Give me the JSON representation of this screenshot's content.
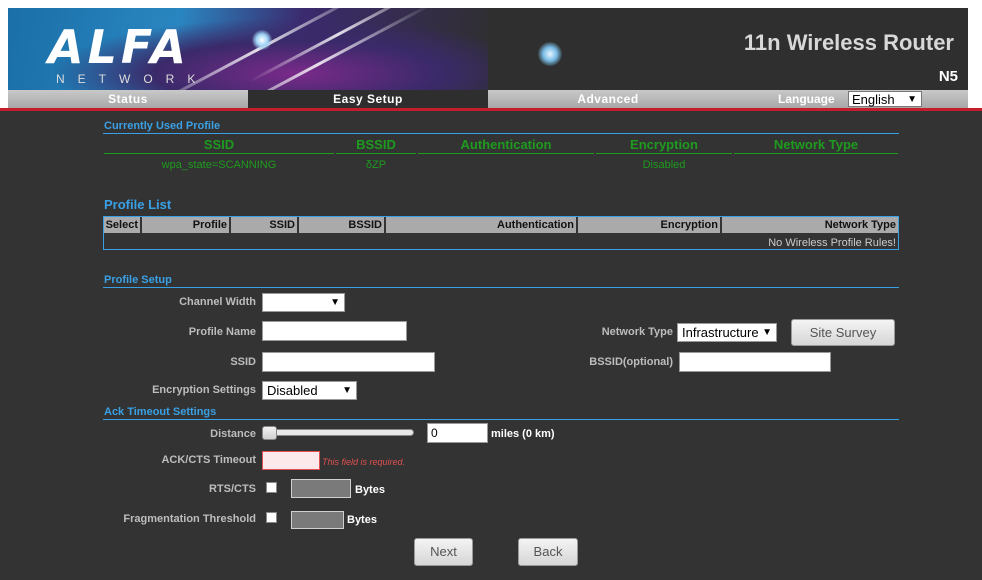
{
  "header": {
    "logo_text": "ALFA",
    "logo_subtext": "NETWORK",
    "product_title": "11n Wireless Router",
    "model": "N5"
  },
  "nav": {
    "tabs": [
      {
        "label": "Status"
      },
      {
        "label": "Easy Setup"
      },
      {
        "label": "Advanced"
      }
    ],
    "language_label": "Language",
    "language_value": "English"
  },
  "current_profile": {
    "title": "Currently Used Profile",
    "columns": [
      "SSID",
      "BSSID",
      "Authentication",
      "Encryption",
      "Network Type"
    ],
    "values": [
      "wpa_state=SCANNING",
      "δZP",
      "",
      "Disabled",
      ""
    ]
  },
  "profile_list": {
    "title": "Profile List",
    "columns": [
      "Select",
      "Profile",
      "SSID",
      "BSSID",
      "Authentication",
      "Encryption",
      "Network Type"
    ],
    "empty_message": "No Wireless Profile Rules!"
  },
  "profile_setup": {
    "title": "Profile Setup",
    "channel_width_label": "Channel Width",
    "channel_width_value": "",
    "profile_name_label": "Profile Name",
    "network_type_label": "Network Type",
    "network_type_value": "Infrastructure",
    "site_survey_label": "Site Survey",
    "ssid_label": "SSID",
    "bssid_label": "BSSID(optional)",
    "encryption_label": "Encryption Settings",
    "encryption_value": "Disabled"
  },
  "ack_timeout": {
    "title": "Ack Timeout Settings",
    "distance_label": "Distance",
    "distance_value": "0",
    "distance_unit": "miles (0 km)",
    "ack_cts_label": "ACK/CTS Timeout",
    "ack_cts_error": "This field is required.",
    "rts_cts_label": "RTS/CTS",
    "rts_cts_unit": "Bytes",
    "frag_label": "Fragmentation Threshold",
    "frag_unit": "Bytes"
  },
  "actions": {
    "next_label": "Next",
    "back_label": "Back"
  },
  "colors": {
    "accent_blue": "#3aa0e6",
    "status_green": "#1e9b1e",
    "brand_red": "#c41e2a",
    "error_red": "#e05050"
  }
}
